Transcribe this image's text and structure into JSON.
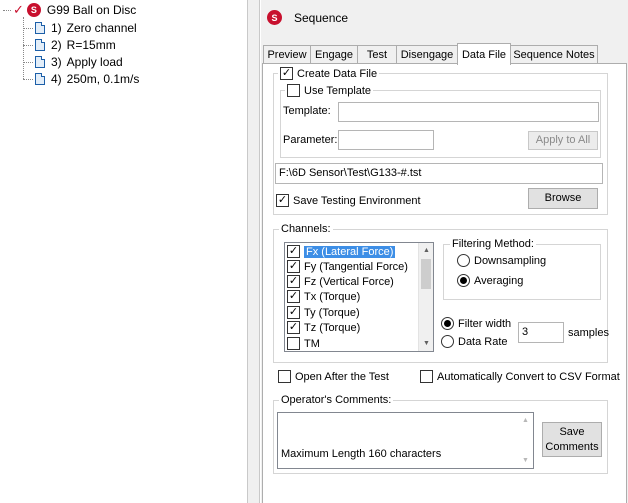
{
  "tree": {
    "root": {
      "label": "G99 Ball on Disc",
      "logo_letter": "S"
    },
    "steps": [
      {
        "number": "1)",
        "label": "Zero channel"
      },
      {
        "number": "2)",
        "label": "R=15mm"
      },
      {
        "number": "3)",
        "label": "Apply load"
      },
      {
        "number": "4)",
        "label": "250m, 0.1m/s"
      }
    ]
  },
  "panel": {
    "title": "Sequence",
    "logo_letter": "S",
    "tabs": [
      {
        "label": "Preview",
        "active": false
      },
      {
        "label": "Engage",
        "active": false
      },
      {
        "label": "Test",
        "active": false
      },
      {
        "label": "Disengage",
        "active": false
      },
      {
        "label": "Data File",
        "active": true
      },
      {
        "label": "Sequence Notes",
        "active": false
      }
    ]
  },
  "datafile": {
    "create_data_file": {
      "label": "Create Data File",
      "checked": true
    },
    "use_template": {
      "label": "Use Template",
      "checked": false
    },
    "template_label": "Template:",
    "template_value": "",
    "parameter_label": "Parameter:",
    "parameter_value": "",
    "apply_to_all": "Apply to All",
    "file_path": "F:\\6D Sensor\\Test\\G133-#.tst",
    "save_env": {
      "label": "Save Testing Environment",
      "checked": true
    },
    "browse": "Browse"
  },
  "channels": {
    "label": "Channels:",
    "items": [
      {
        "label": "Fx (Lateral Force)",
        "checked": true,
        "selected": true
      },
      {
        "label": "Fy (Tangential Force)",
        "checked": true,
        "selected": false
      },
      {
        "label": "Fz (Vertical Force)",
        "checked": true,
        "selected": false
      },
      {
        "label": "Tx (Torque)",
        "checked": true,
        "selected": false
      },
      {
        "label": "Ty (Torque)",
        "checked": true,
        "selected": false
      },
      {
        "label": "Tz (Torque)",
        "checked": true,
        "selected": false
      },
      {
        "label": "TM",
        "checked": false,
        "selected": false
      }
    ],
    "filtering": {
      "label": "Filtering Method:",
      "downsampling": {
        "label": "Downsampling",
        "checked": false
      },
      "averaging": {
        "label": "Averaging",
        "checked": true
      }
    },
    "filter_width": {
      "label": "Filter width",
      "checked": true
    },
    "data_rate": {
      "label": "Data Rate",
      "checked": false
    },
    "samples_value": "3",
    "samples_label": "samples"
  },
  "options": {
    "open_after": {
      "label": "Open After the Test",
      "checked": false
    },
    "auto_convert": {
      "label": "Automatically Convert to CSV Format",
      "checked": false
    }
  },
  "comments": {
    "label": "Operator's Comments:",
    "hint": "Maximum Length 160 characters",
    "save_button": "Save Comments"
  },
  "colors": {
    "logo_red": "#c8102e",
    "selection_blue": "#3d8ee6",
    "panel_bg": "#f0f0f0"
  }
}
